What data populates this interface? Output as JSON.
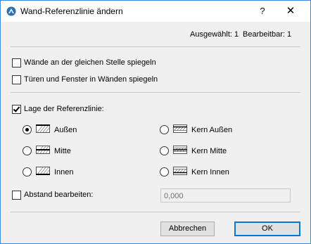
{
  "window": {
    "title": "Wand-Referenzlinie ändern",
    "help_label": "?",
    "close_label": "✕",
    "accent": "#3c8ad8"
  },
  "status": {
    "selected": "Ausgewählt: 1",
    "editable": "Bearbeitbar: 1"
  },
  "options": {
    "mirror_walls": {
      "label": "Wände an der gleichen Stelle spiegeln",
      "checked": false
    },
    "mirror_doors": {
      "label": "Türen und Fenster in Wänden spiegeln",
      "checked": false
    },
    "ref_line": {
      "label": "Lage der Referenzlinie:",
      "checked": true
    }
  },
  "radios": [
    {
      "label": "Außen",
      "selected": true,
      "icon": "wall-outside-icon"
    },
    {
      "label": "Mitte",
      "selected": false,
      "icon": "wall-center-icon"
    },
    {
      "label": "Innen",
      "selected": false,
      "icon": "wall-inside-icon"
    },
    {
      "label": "Kern Außen",
      "selected": false,
      "icon": "core-outside-icon"
    },
    {
      "label": "Kern Mitte",
      "selected": false,
      "icon": "core-center-icon"
    },
    {
      "label": "Kern Innen",
      "selected": false,
      "icon": "core-inside-icon"
    }
  ],
  "offset": {
    "label": "Abstand bearbeiten:",
    "checked": false,
    "value": "0,000"
  },
  "buttons": {
    "cancel": "Abbrechen",
    "ok": "OK"
  }
}
